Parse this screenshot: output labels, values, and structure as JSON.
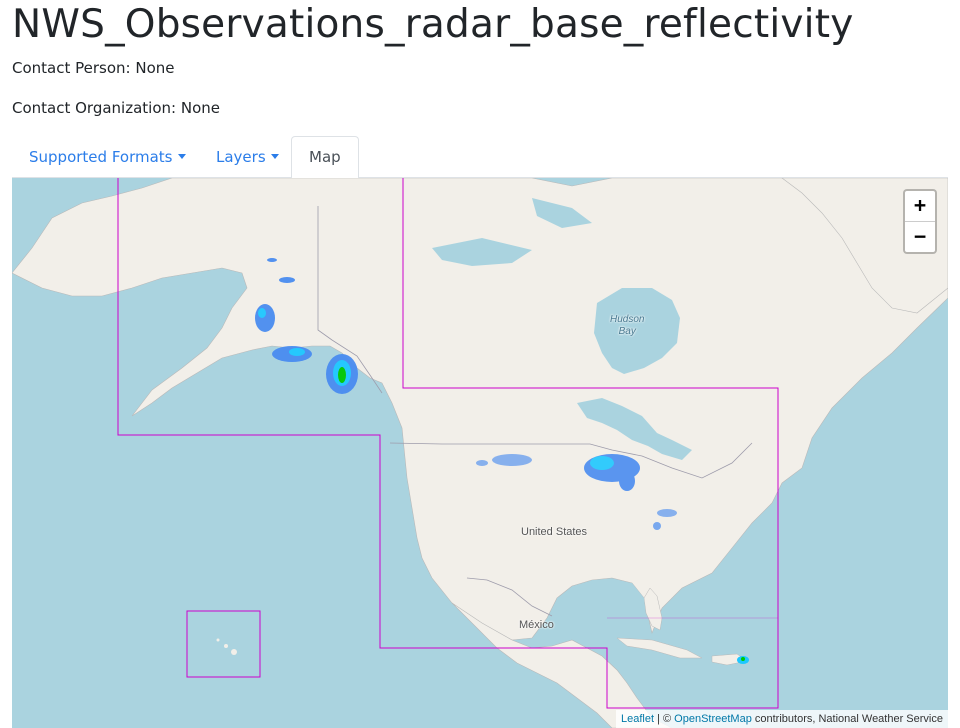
{
  "page": {
    "title": "NWS_Observations_radar_base_reflectivity",
    "contact_person": "Contact Person: None",
    "contact_organization": "Contact Organization: None"
  },
  "tabs": [
    {
      "label": "Supported Formats",
      "dropdown": true,
      "active": false
    },
    {
      "label": "Layers",
      "dropdown": true,
      "active": false
    },
    {
      "label": "Map",
      "dropdown": false,
      "active": true
    }
  ],
  "map": {
    "labels": {
      "hudson_bay": "Hudson\nBay",
      "united_states": "United States",
      "mexico": "México"
    },
    "zoom_in": "+",
    "zoom_out": "−",
    "attribution": {
      "leaflet": "Leaflet",
      "sep": " | © ",
      "osm": "OpenStreetMap",
      "rest": " contributors, National Weather Service"
    },
    "colors": {
      "water": "#aad3df",
      "land": "#f2efe9",
      "coverage_outline": "#cc00cc",
      "radar_light": "#4a8cf0",
      "radar_mid": "#1ec8ff",
      "radar_strong": "#00c800"
    }
  }
}
